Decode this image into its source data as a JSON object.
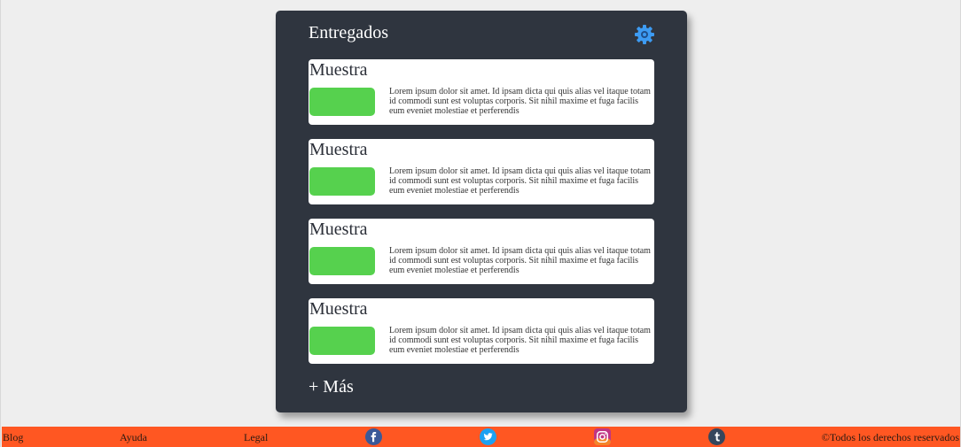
{
  "panel": {
    "title": "Entregados",
    "more_label": "+ Más",
    "icon": "gear-icon"
  },
  "cards": [
    {
      "title": "Muestra",
      "text": "Lorem ipsum dolor sit amet. Id ipsam dicta qui quis alias vel itaque totam id commodi sunt est voluptas corporis. Sit nihil maxime et fuga facilis eum eveniet molestiae et perferendis"
    },
    {
      "title": "Muestra",
      "text": "Lorem ipsum dolor sit amet. Id ipsam dicta qui quis alias vel itaque totam id commodi sunt est voluptas corporis. Sit nihil maxime et fuga facilis eum eveniet molestiae et perferendis"
    },
    {
      "title": "Muestra",
      "text": "Lorem ipsum dolor sit amet. Id ipsam dicta qui quis alias vel itaque totam id commodi sunt est voluptas corporis. Sit nihil maxime et fuga facilis eum eveniet molestiae et perferendis"
    },
    {
      "title": "Muestra",
      "text": "Lorem ipsum dolor sit amet. Id ipsam dicta qui quis alias vel itaque totam id commodi sunt est voluptas corporis. Sit nihil maxime et fuga facilis eum eveniet molestiae et perferendis"
    }
  ],
  "footer": {
    "links": [
      "Blog",
      "Ayuda",
      "Legal"
    ],
    "social_icons": [
      "facebook-icon",
      "twitter-icon",
      "instagram-icon",
      "tumblr-icon"
    ],
    "copyright": "©Todos los derechos reservados"
  },
  "colors": {
    "page_bg": "#eeeeee",
    "panel_bg": "#2f353f",
    "card_bg": "#ffffff",
    "accent_green": "#56d14e",
    "footer_bg": "#ff5722",
    "gear_blue": "#3d9bf2"
  }
}
